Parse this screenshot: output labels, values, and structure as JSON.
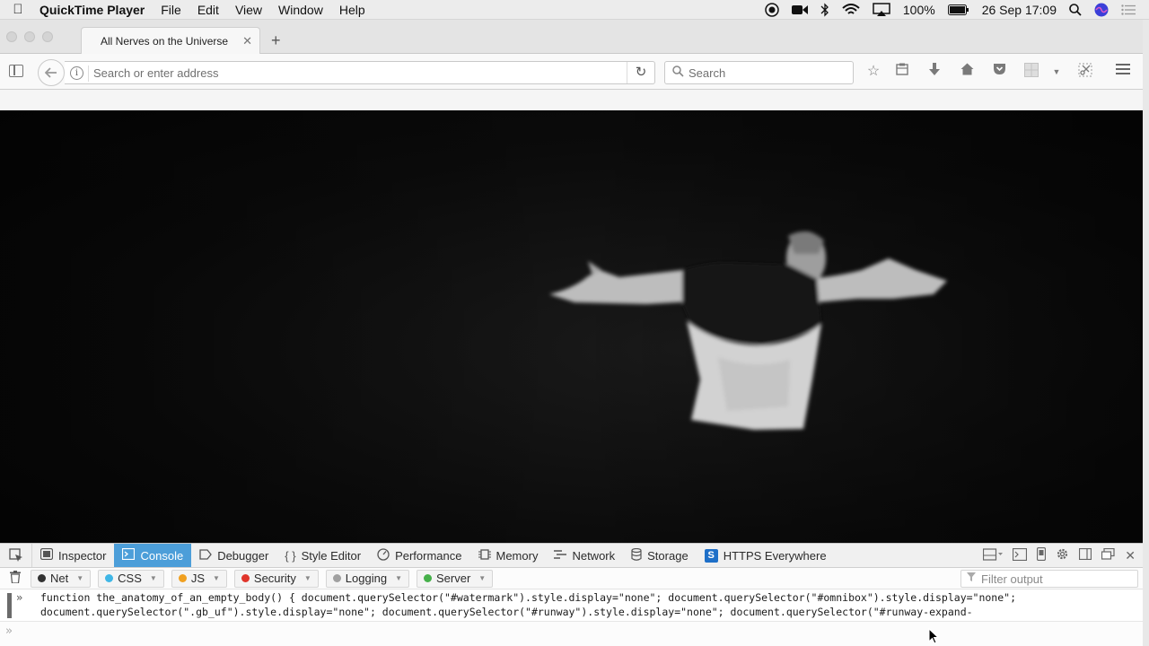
{
  "menubar": {
    "app_name": "QuickTime Player",
    "items": [
      "File",
      "Edit",
      "View",
      "Window",
      "Help"
    ],
    "battery": "100%",
    "datetime": "26 Sep  17:09"
  },
  "browser": {
    "tab_title": "All Nerves on the Universe",
    "url_placeholder": "Search or enter address",
    "search_placeholder": "Search"
  },
  "devtools": {
    "tabs": [
      {
        "label": "Inspector",
        "icon": "inspector-icon"
      },
      {
        "label": "Console",
        "icon": "console-icon",
        "active": true
      },
      {
        "label": "Debugger",
        "icon": "debugger-icon"
      },
      {
        "label": "Style Editor",
        "icon": "braces-icon"
      },
      {
        "label": "Performance",
        "icon": "gauge-icon"
      },
      {
        "label": "Memory",
        "icon": "memory-icon"
      },
      {
        "label": "Network",
        "icon": "network-icon"
      },
      {
        "label": "Storage",
        "icon": "storage-icon"
      },
      {
        "label": "HTTPS Everywhere",
        "icon": "https-everywhere-icon"
      }
    ],
    "filters": [
      {
        "label": "Net",
        "color": "#333333"
      },
      {
        "label": "CSS",
        "color": "#3fb6e6"
      },
      {
        "label": "JS",
        "color": "#f0a020"
      },
      {
        "label": "Security",
        "color": "#e0352b"
      },
      {
        "label": "Logging",
        "color": "#a0a0a0"
      },
      {
        "label": "Server",
        "color": "#46b04a"
      }
    ],
    "filter_output_placeholder": "Filter output",
    "console_line_1": "function the_anatomy_of_an_empty_body() { document.querySelector(\"#watermark\").style.display=\"none\"; document.querySelector(\"#omnibox\").style.display=\"none\";",
    "console_line_2": "document.querySelector(\".gb_uf\").style.display=\"none\"; document.querySelector(\"#runway\").style.display=\"none\"; document.querySelector(\"#runway-expand-"
  },
  "colors": {
    "active_tab": "#4c9ed9",
    "video_bg": "#0b0b0b"
  }
}
